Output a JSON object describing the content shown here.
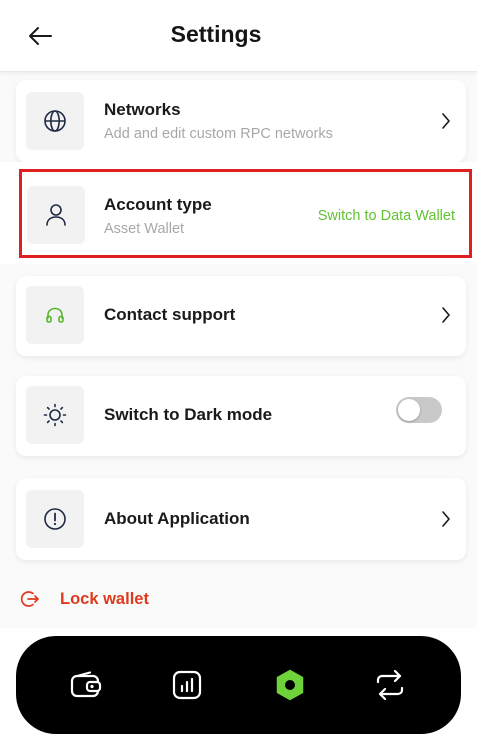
{
  "header": {
    "title": "Settings",
    "back_icon": "arrow-left-icon"
  },
  "settings": {
    "networks": {
      "title": "Networks",
      "subtitle": "Add and edit custom RPC networks",
      "icon": "globe-icon"
    },
    "account_type": {
      "title": "Account type",
      "subtitle": "Asset Wallet",
      "action_label": "Switch to Data Wallet",
      "icon": "user-icon"
    },
    "contact_support": {
      "title": "Contact support",
      "icon": "headphones-icon"
    },
    "dark_mode": {
      "title": "Switch to Dark mode",
      "icon": "sun-icon",
      "toggle_on": false
    },
    "about": {
      "title": "About Application",
      "icon": "info-circle-icon"
    }
  },
  "lock": {
    "label": "Lock wallet",
    "icon": "logout-icon"
  },
  "bottom_nav": {
    "items": [
      {
        "icon": "wallet-icon",
        "active": false
      },
      {
        "icon": "bar-chart-icon",
        "active": false
      },
      {
        "icon": "hexagon-icon",
        "active": true
      },
      {
        "icon": "swap-icon",
        "active": false
      }
    ]
  },
  "colors": {
    "accent_green": "#62c232",
    "lock_red": "#e03a1e",
    "highlight_red": "#e02020",
    "navbar_bg": "#000000"
  }
}
